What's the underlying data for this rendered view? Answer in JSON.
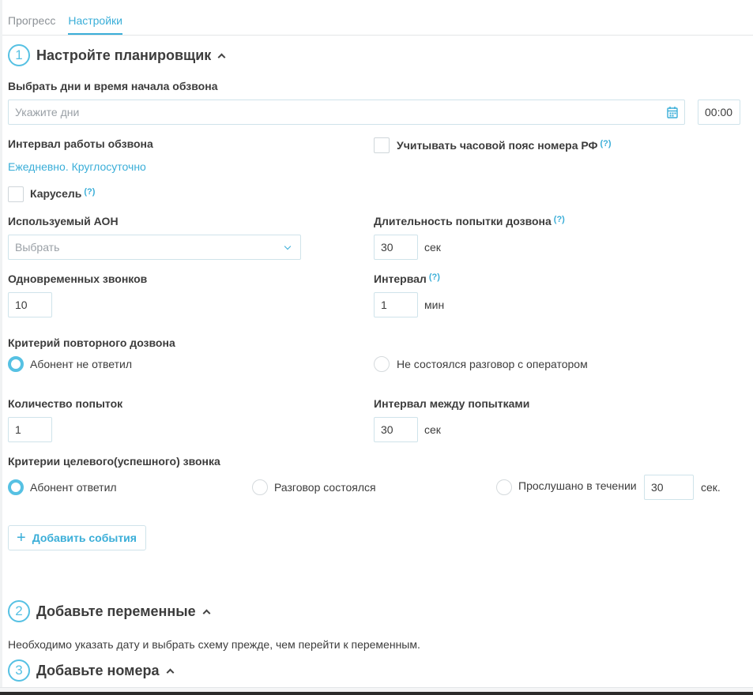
{
  "tabs": [
    {
      "label": "Прогресс",
      "active": false
    },
    {
      "label": "Настройки",
      "active": true
    }
  ],
  "steps": {
    "s1": {
      "num": "1",
      "title": "Настройте планировщик"
    },
    "s2": {
      "num": "2",
      "title": "Добавьте переменные"
    },
    "s3": {
      "num": "3",
      "title": "Добавьте номера"
    }
  },
  "schedule": {
    "label": "Выбрать дни и время начала обзвона",
    "days_placeholder": "Укажите дни",
    "time_value": "00:00"
  },
  "work_interval": {
    "label": "Интервал работы обзвона",
    "value": "Ежедневно. Круглосуточно"
  },
  "timezone": {
    "label": "Учитывать часовой пояс номера РФ",
    "hint": "(?)",
    "checked": false
  },
  "carousel": {
    "label": "Карусель",
    "hint": "(?)",
    "checked": false
  },
  "aon": {
    "label": "Используемый АОН",
    "placeholder": "Выбрать"
  },
  "duration": {
    "label": "Длительность попытки дозвона",
    "hint": "(?)",
    "value": "30",
    "unit": "сек"
  },
  "simultaneous": {
    "label": "Одновременных звонков",
    "value": "10"
  },
  "interval": {
    "label": "Интервал",
    "hint": "(?)",
    "value": "1",
    "unit": "мин"
  },
  "retry": {
    "label": "Критерий повторного дозвона",
    "options": [
      "Абонент не ответил",
      "Не состоялся разговор с оператором"
    ],
    "selected": 0
  },
  "attempts": {
    "label": "Количество попыток",
    "value": "1"
  },
  "attempt_interval": {
    "label": "Интервал между попытками",
    "value": "30",
    "unit": "сек"
  },
  "success": {
    "label": "Критерии целевого(успешного) звонка",
    "options": [
      "Абонент ответил",
      "Разговор состоялся",
      "Прослушано в течении"
    ],
    "listen_value": "30",
    "listen_unit": "сек.",
    "selected": 0
  },
  "add_events": {
    "label": "Добавить события",
    "icon": "plus-icon"
  },
  "variables_note": "Необходимо указать дату и выбрать схему прежде, чем перейти к переменным.",
  "colors": {
    "accent": "#3aaed8",
    "step_circle": "#56c1e3",
    "text": "#3c3c3c",
    "border": "#cfe3ea"
  }
}
